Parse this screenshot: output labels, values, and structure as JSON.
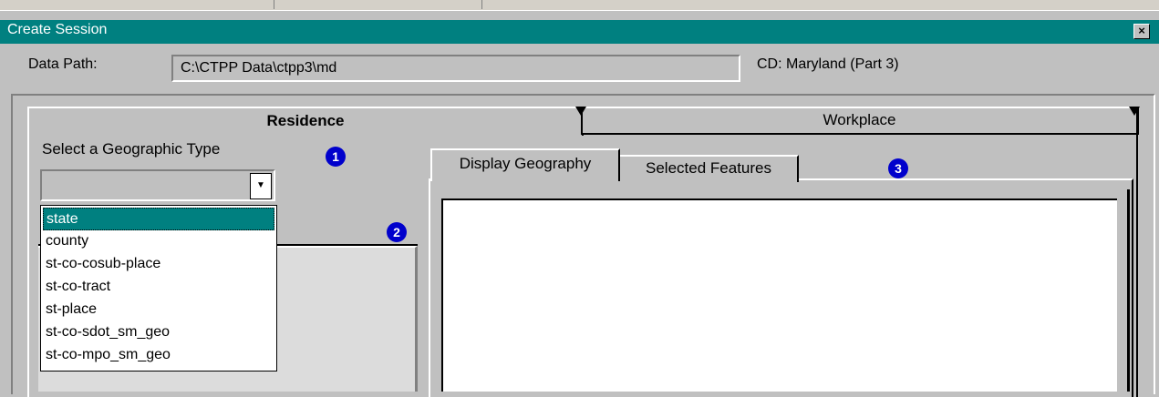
{
  "window": {
    "title": "Create Session",
    "close_glyph": "×"
  },
  "path_row": {
    "label": "Data Path:",
    "value": "C:\\CTPP Data\\ctpp3\\md",
    "cd_label": "CD: Maryland (Part 3)"
  },
  "outer_tabs": [
    {
      "label": "Residence",
      "active": true
    },
    {
      "label": "Workplace",
      "active": false
    }
  ],
  "residence": {
    "geo_type_label": "Select a Geographic Type",
    "select_value": "",
    "dropdown_arrow": "▼",
    "options": [
      "state",
      "county",
      "st-co-cosub-place",
      "st-co-tract",
      "st-place",
      "st-co-sdot_sm_geo",
      "st-co-mpo_sm_geo"
    ],
    "selected_index": 0
  },
  "inner_tabs": [
    {
      "label": "Display Geography",
      "active": true
    },
    {
      "label": "Selected Features",
      "active": false
    }
  ],
  "badges": [
    "1",
    "2",
    "3"
  ],
  "colors": {
    "titlebar": "#008080",
    "window_bg": "#c0c0c0",
    "selection": "#008080",
    "badge": "#0000cc"
  }
}
